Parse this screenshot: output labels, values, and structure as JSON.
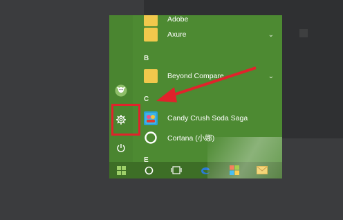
{
  "start_menu": {
    "rail": {
      "user_icon": "user-avatar-icon",
      "settings_icon": "gear-icon",
      "power_icon": "power-icon"
    },
    "apps_partial_top": "Adobe",
    "sections": [
      {
        "letter": "B"
      },
      {
        "letter": "C"
      },
      {
        "letter": "E"
      }
    ],
    "apps": [
      {
        "label": "Axure",
        "expand": "⌄"
      },
      {
        "label": "Beyond Compare",
        "expand": "⌄"
      },
      {
        "label": "Candy Crush Soda Saga"
      },
      {
        "label": "Cortana (小娜)"
      }
    ]
  },
  "taskbar": {
    "items": [
      "windows-start-icon",
      "search-circle-icon",
      "task-view-icon",
      "edge-icon",
      "store-icon",
      "mail-icon"
    ]
  },
  "annotation": {
    "highlight_color": "#e0232b",
    "arrow_color": "#e0232b"
  }
}
